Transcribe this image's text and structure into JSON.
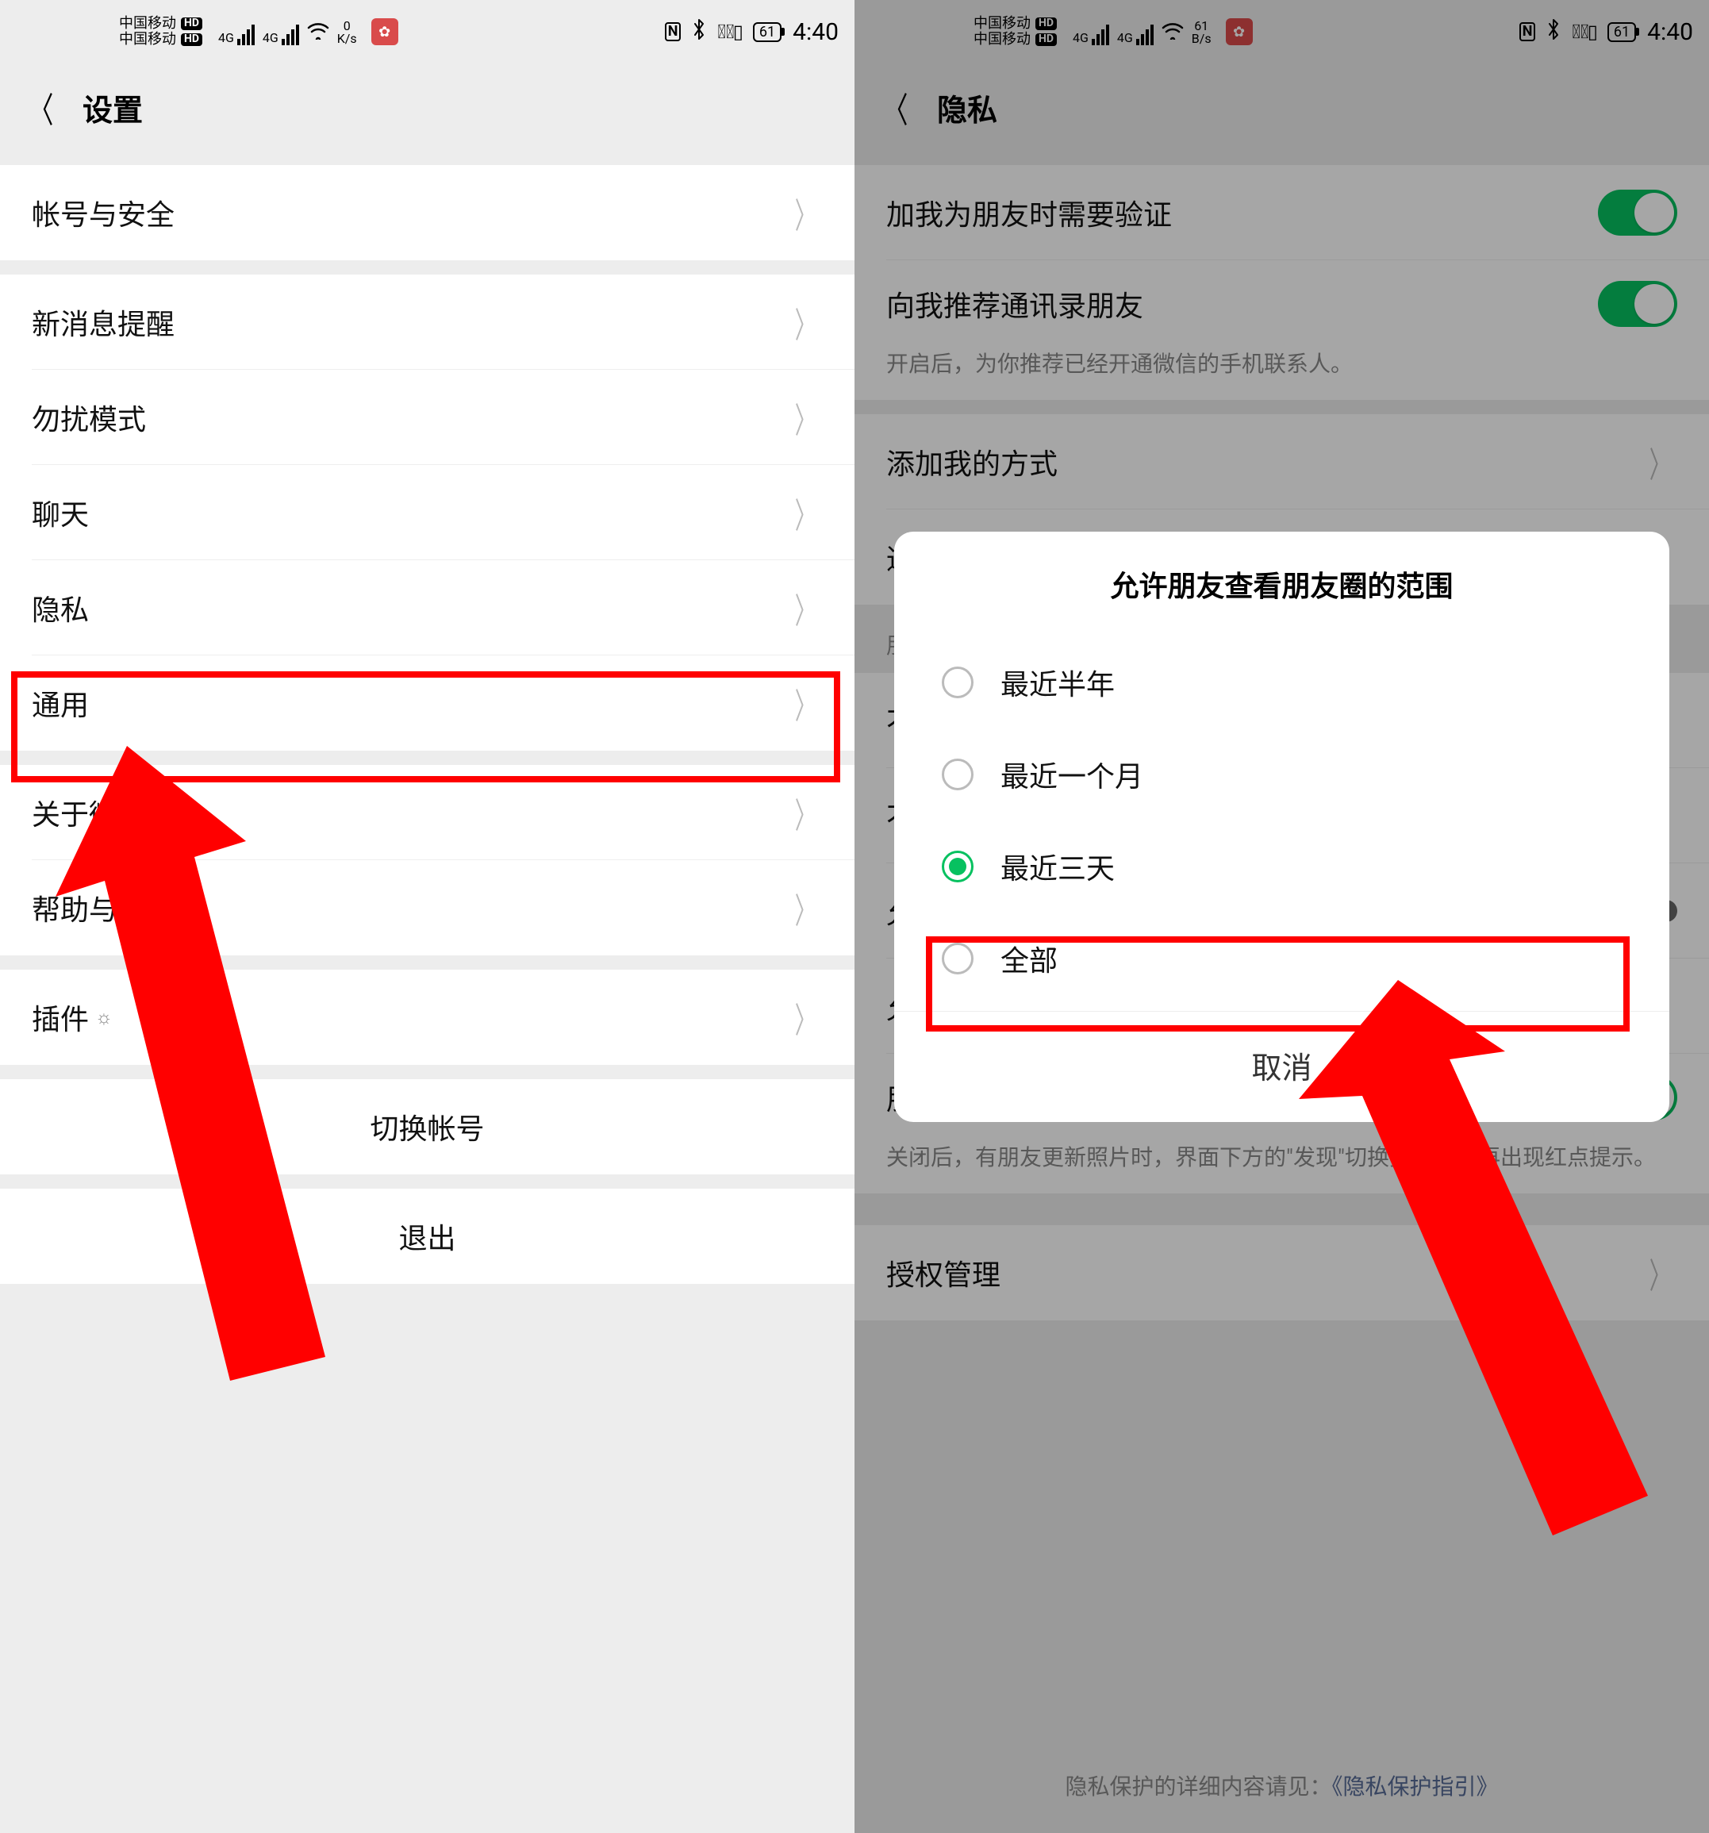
{
  "status": {
    "carrier": "中国移动",
    "hd": "HD",
    "net": "4G",
    "speed_left_num": "0",
    "speed_left_unit": "K/s",
    "speed_right_num": "61",
    "speed_right_unit": "B/s",
    "nfc": "N",
    "battery": "61",
    "time": "4:40"
  },
  "left": {
    "title": "设置",
    "items": {
      "account": "帐号与安全",
      "new_msg": "新消息提醒",
      "dnd": "勿扰模式",
      "chat": "聊天",
      "privacy": "隐私",
      "general": "通用",
      "about": "关于微信",
      "help": "帮助与反馈",
      "plugin": "插件",
      "switch": "切换帐号",
      "logout": "退出"
    }
  },
  "right": {
    "title": "隐私",
    "verify": "加我为朋友时需要验证",
    "recommend": "向我推荐通讯录朋友",
    "recommend_sub": "开启后，为你推荐已经开通微信的手机联系人。",
    "add_way": "添加我的方式",
    "contacts_bl": "通讯录黑名单",
    "moments_hdr": "朋友圈和视频动态",
    "not_let_see": "不让他(她)看",
    "not_see": "不看他(她)",
    "allow_strangers": "允许陌生人查看十条朋友圈",
    "allow_range_label": "允许朋友查看朋友圈的范围",
    "allow_range_val": "最近三天",
    "update_remind": "朋友圈更新提醒",
    "update_remind_sub": "关闭后，有朋友更新照片时，界面下方的\"发现\"切换按钮上不再出现红点提示。",
    "auth": "授权管理",
    "footer_pre": "隐私保护的详细内容请见：",
    "footer_link": "《隐私保护指引》"
  },
  "dialog": {
    "title": "允许朋友查看朋友圈的范围",
    "opt1": "最近半年",
    "opt2": "最近一个月",
    "opt3": "最近三天",
    "opt4": "全部",
    "cancel": "取消"
  }
}
